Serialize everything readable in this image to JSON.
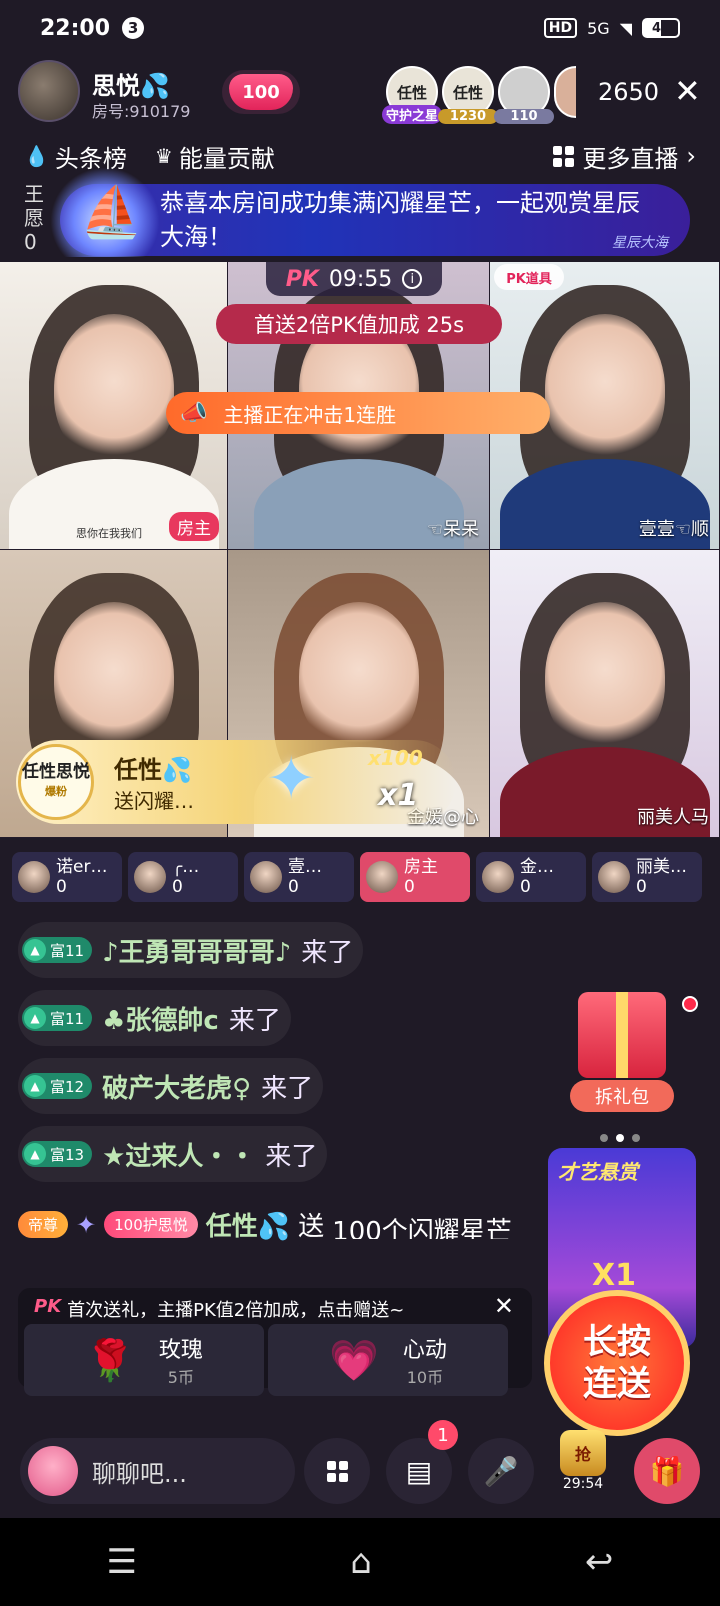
{
  "status": {
    "time": "22:00",
    "notif_count": "3",
    "hd": "HD",
    "signal": "5G",
    "battery": "49"
  },
  "host": {
    "name": "思悦💦",
    "room": "房号:910179",
    "likes": "100"
  },
  "viewers": [
    {
      "label": "任性",
      "badge": "守护之星"
    },
    {
      "label": "任性",
      "badge": "1230"
    },
    {
      "label": "",
      "badge": "110"
    }
  ],
  "viewer_count": "2650",
  "rank": {
    "headline": "头条榜",
    "energy": "能量贡献",
    "more": "更多直播"
  },
  "banner": {
    "left_cut": "王\n愿\n0",
    "text": "恭喜本房间成功集满闪耀星芒，一起观赏星辰大海！",
    "tag": "星辰大海"
  },
  "pk": {
    "label": "PK",
    "timer": "09:55",
    "bonus": "首送2倍PK值加成 25s",
    "tool": "PK道具",
    "streak": "主播正在冲击1连胜"
  },
  "tiles": [
    {
      "name": "",
      "host_tag": "房主",
      "caption": "思你在我我们"
    },
    {
      "name": "☜呆呆"
    },
    {
      "name": "壹壹☜顺"
    },
    {
      "name": ""
    },
    {
      "name": "金媛@心"
    },
    {
      "name": "丽美人马"
    }
  ],
  "gift_float": {
    "avatar_text": "任性思悦",
    "avatar_sub": "爆粉",
    "sender": "任性💦",
    "action": "送闪耀…",
    "multiplier_small": "x100",
    "multiplier": "x1"
  },
  "pk_scores": [
    {
      "name": "诺er…",
      "score": "0"
    },
    {
      "name": "╭…",
      "score": "0"
    },
    {
      "name": "壹…",
      "score": "0"
    },
    {
      "name": "房主",
      "score": "0"
    },
    {
      "name": "金…",
      "score": "0"
    },
    {
      "name": "丽美…",
      "score": "0"
    }
  ],
  "chat": [
    {
      "level": "富11",
      "name": "♪王勇哥哥哥哥♪",
      "action": "来了"
    },
    {
      "level": "富11",
      "name": "♣张德帥c",
      "action": "来了"
    },
    {
      "level": "富12",
      "name": "破产大老虎♀",
      "action": "来了"
    },
    {
      "level": "富13",
      "name": "★过来人・・",
      "action": "来了"
    }
  ],
  "gift_chat": {
    "emperor": "帝尊",
    "guard": "100护思悦",
    "sender": "任性💦",
    "verb": "送",
    "gift": "100个闪耀星芒"
  },
  "gift_hint": {
    "pk": "PK",
    "text": "首次送礼，主播PK值2倍加成，点击赠送~",
    "options": [
      {
        "icon": "🌹",
        "name": "玫瑰",
        "price": "5币"
      },
      {
        "icon": "💗",
        "name": "心动",
        "price": "10币"
      }
    ]
  },
  "side": {
    "red_pack": "拆礼包",
    "talent_title": "才艺悬赏",
    "talent_multiplier": "X1",
    "press_line1": "长按",
    "press_line2": "连送"
  },
  "bottom": {
    "placeholder": "聊聊吧...",
    "msg_badge": "1",
    "grab_label": "抢",
    "grab_timer": "29:54"
  }
}
